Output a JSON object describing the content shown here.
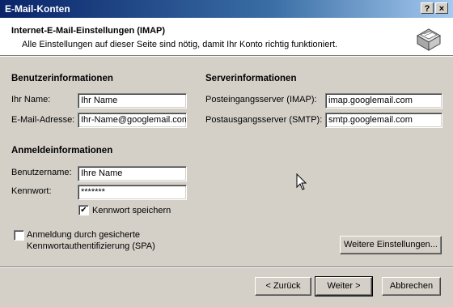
{
  "window": {
    "title": "E-Mail-Konten",
    "help_label": "?",
    "close_label": "×"
  },
  "header": {
    "title": "Internet-E-Mail-Einstellungen (IMAP)",
    "subtitle": "Alle Einstellungen auf dieser Seite sind nötig, damit Ihr Konto richtig funktioniert.",
    "icon": "email-envelope-icon"
  },
  "user_info": {
    "heading": "Benutzerinformationen",
    "name_label": "Ihr Name:",
    "name_value": "Ihr Name",
    "email_label": "E-Mail-Adresse:",
    "email_value": "Ihr-Name@googlemail.com"
  },
  "server_info": {
    "heading": "Serverinformationen",
    "incoming_label": "Posteingangsserver (IMAP):",
    "incoming_value": "imap.googlemail.com",
    "outgoing_label": "Postausgangsserver (SMTP):",
    "outgoing_value": "smtp.googlemail.com"
  },
  "logon_info": {
    "heading": "Anmeldeinformationen",
    "username_label": "Benutzername:",
    "username_value": "Ihre Name",
    "password_label": "Kennwort:",
    "password_value": "*******",
    "remember_label": "Kennwort speichern",
    "remember_checked": true,
    "spa_label_line1": "Anmeldung durch gesicherte",
    "spa_label_line2": "Kennwortauthentifizierung (SPA)",
    "spa_checked": false
  },
  "buttons": {
    "more_settings": "Weitere Einstellungen...",
    "back": "< Zurück",
    "next": "Weiter >",
    "cancel": "Abbrechen"
  }
}
